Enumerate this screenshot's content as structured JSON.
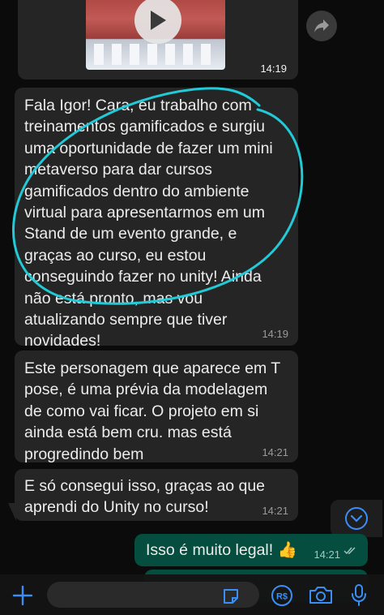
{
  "chat": {
    "video_message": {
      "time": "14:19"
    },
    "messages": [
      {
        "text": "Fala Igor! Cara, eu trabalho com\ntreinamentos gamificados e surgiu\numa oportunidade de fazer um mini\nmetaverso para dar cursos\ngamificados dentro do ambiente\nvirtual para apresentarmos em um\nStand de um evento grande, e\ngraças ao curso, eu estou\nconseguindo fazer no unity! Ainda\nnão está pronto, mas vou\natualizando sempre que tiver\nnovidades!",
        "time": "14:19"
      },
      {
        "text": "Este personagem que aparece em T\npose, é uma prévia da modelagem\nde como vai ficar. O projeto em si\nainda está bem cru. mas está\nprogredindo bem",
        "time": "14:21"
      },
      {
        "text": "E só consegui isso, graças ao que\naprendi do Unity no curso!",
        "time": "14:21"
      }
    ],
    "outgoing": {
      "text": "Isso é muito legal! 👍",
      "time": "14:21"
    }
  },
  "colors": {
    "incoming_bubble": "#252525",
    "outgoing_bubble": "#054d3e",
    "accent": "#3a8ef5",
    "annotation": "#22c9d6"
  },
  "icons": {
    "play": "play-icon",
    "forward": "forward-icon",
    "scroll": "chevron-down-icon",
    "plus": "plus-icon",
    "sticker": "sticker-icon",
    "pay": "payment-icon",
    "camera": "camera-icon",
    "mic": "microphone-icon"
  }
}
